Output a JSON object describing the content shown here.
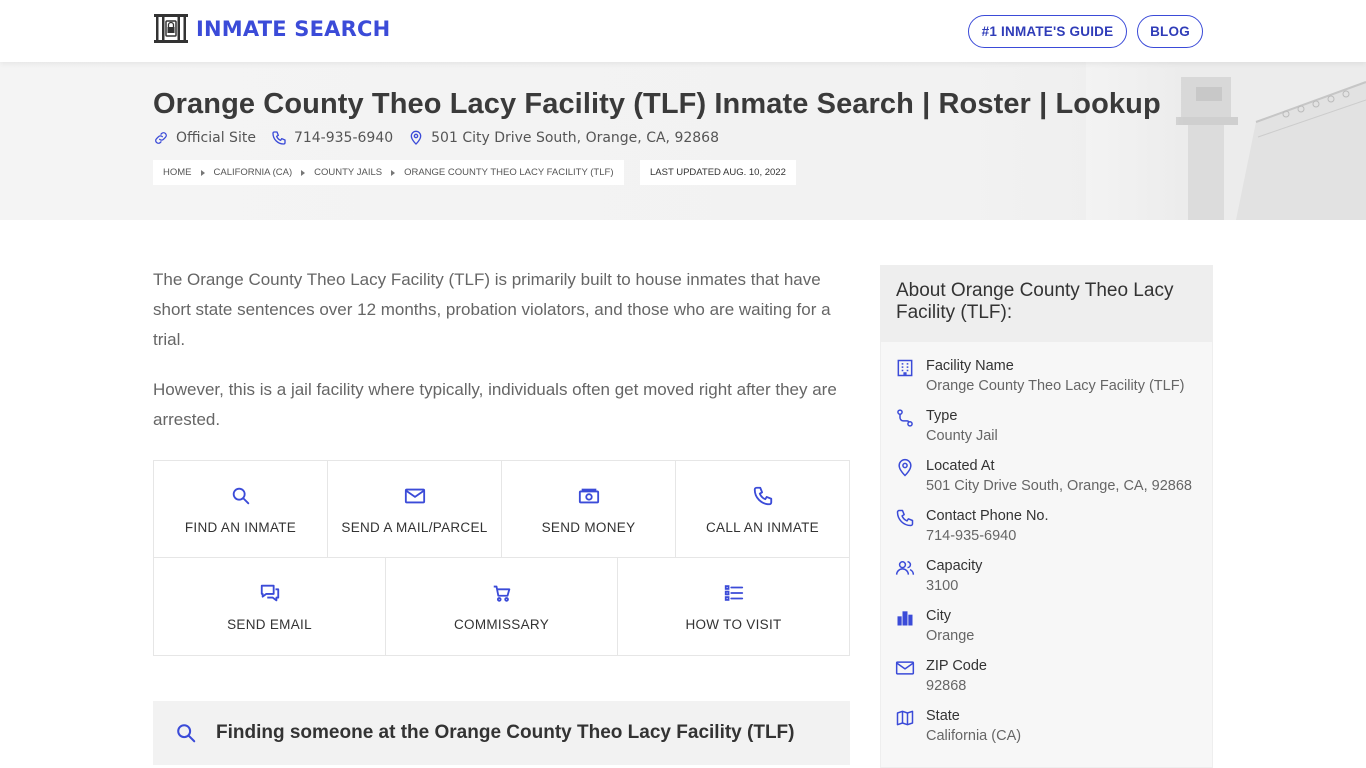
{
  "header": {
    "logo_text": "INMATE SEARCH",
    "nav": [
      {
        "label": "#1 INMATE'S GUIDE"
      },
      {
        "label": "BLOG"
      }
    ]
  },
  "hero": {
    "title": "Orange County Theo Lacy Facility (TLF) Inmate Search | Roster | Lookup",
    "official_site": "Official Site",
    "phone": "714-935-6940",
    "address": "501 City Drive South, Orange, CA, 92868",
    "breadcrumbs": [
      "HOME",
      "CALIFORNIA (CA)",
      "COUNTY JAILS",
      "ORANGE COUNTY THEO LACY FACILITY (TLF)"
    ],
    "last_updated": "LAST UPDATED AUG. 10, 2022"
  },
  "intro": {
    "p1": "The Orange County Theo Lacy Facility (TLF) is primarily built to house inmates that have short state sentences over 12 months, probation violators, and those who are waiting for a trial.",
    "p2": "However, this is a jail facility where typically, individuals often get moved right after they are arrested."
  },
  "actions": {
    "row1": [
      {
        "label": "FIND AN INMATE",
        "icon": "search-icon"
      },
      {
        "label": "SEND A MAIL/PARCEL",
        "icon": "mail-icon"
      },
      {
        "label": "SEND MONEY",
        "icon": "money-icon"
      },
      {
        "label": "CALL AN INMATE",
        "icon": "phone-icon"
      }
    ],
    "row2": [
      {
        "label": "SEND EMAIL",
        "icon": "chat-icon"
      },
      {
        "label": "COMMISSARY",
        "icon": "cart-icon"
      },
      {
        "label": "HOW TO VISIT",
        "icon": "list-icon"
      }
    ]
  },
  "finding": {
    "heading": "Finding someone at the Orange County Theo Lacy Facility (TLF)"
  },
  "about": {
    "title": "About Orange County Theo Lacy Facility (TLF):",
    "rows": [
      {
        "label": "Facility Name",
        "value": "Orange County Theo Lacy Facility (TLF)",
        "icon": "building-icon"
      },
      {
        "label": "Type",
        "value": "County Jail",
        "icon": "route-icon"
      },
      {
        "label": "Located At",
        "value": "501 City Drive South, Orange, CA, 92868",
        "icon": "map-pin-icon"
      },
      {
        "label": "Contact Phone No.",
        "value": "714-935-6940",
        "icon": "phone-icon"
      },
      {
        "label": "Capacity",
        "value": "3100",
        "icon": "users-icon"
      },
      {
        "label": "City",
        "value": "Orange",
        "icon": "city-icon"
      },
      {
        "label": "ZIP Code",
        "value": "92868",
        "icon": "mail-icon"
      },
      {
        "label": "State",
        "value": "California (CA)",
        "icon": "map-icon"
      }
    ]
  },
  "colors": {
    "accent": "#3b4bd8",
    "hero_bg": "#f4f4f4",
    "text": "#333333",
    "muted": "#666666"
  }
}
